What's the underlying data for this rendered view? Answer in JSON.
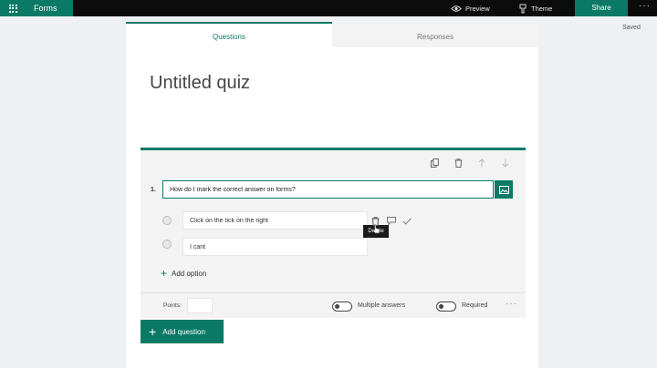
{
  "topbar": {
    "app_name": "Forms",
    "preview_label": "Preview",
    "theme_label": "Theme",
    "share_label": "Share",
    "more_label": "···"
  },
  "status": {
    "saved": "Saved"
  },
  "tabs": [
    {
      "label": "Questions",
      "active": true
    },
    {
      "label": "Responses",
      "active": false
    }
  ],
  "quiz": {
    "title": "Untitled quiz"
  },
  "question": {
    "number": "1.",
    "text": "How do I mark the correct answer on forms?",
    "toolbar_icons": [
      "copy-icon",
      "trash-icon",
      "arrow-up-icon",
      "arrow-down-icon"
    ],
    "options": [
      {
        "text": "Click on the tick on the right"
      },
      {
        "text": "I cant"
      }
    ],
    "delete_tooltip": "Delete",
    "add_option_label": "Add option",
    "points_label": "Points:",
    "points_value": "",
    "multiple_answers_label": "Multiple answers",
    "multiple_answers_on": false,
    "required_label": "Required",
    "required_on": false,
    "more_label": "···"
  },
  "add_question_label": "Add question",
  "colors": {
    "accent": "#0a7a66",
    "topbar": "#0c0c0c",
    "background": "#eef0f1"
  }
}
